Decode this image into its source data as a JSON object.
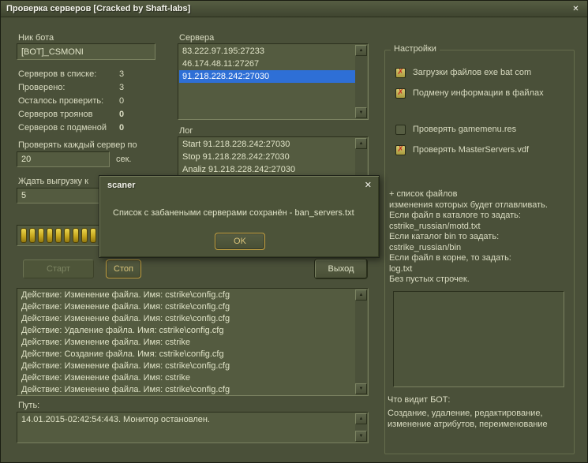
{
  "window": {
    "title": "Проверка серверов [Cracked by Shaft-labs]"
  },
  "icons": {
    "close": "✕",
    "arrow_up": "▲",
    "arrow_down": "▼",
    "check": "✗"
  },
  "left": {
    "nick_label": "Ник бота",
    "nick_value": "[BOT]_CSMONI",
    "stats": [
      {
        "label": "Серверов в списке:",
        "value": "3",
        "bold": false
      },
      {
        "label": "Проверено:",
        "value": "3",
        "bold": false
      },
      {
        "label": "Осталось проверить:",
        "value": "0",
        "bold": false
      },
      {
        "label": "Серверов троянов",
        "value": "0",
        "bold": true
      },
      {
        "label": "Серверов с подменой",
        "value": "0",
        "bold": true
      }
    ],
    "interval_label": "Проверять каждый сервер по",
    "interval_value": "20",
    "interval_unit": "сек.",
    "wait_label": "Ждать выгрузку к",
    "wait_value": "5",
    "start_button": "Старт",
    "stop_button": "Стоп"
  },
  "progress": {
    "blocks": 15
  },
  "servers": {
    "label": "Сервера",
    "items": [
      "83.222.97.195:27233",
      "46.174.48.11:27267",
      "91.218.228.242:27030"
    ],
    "selected_index": 2
  },
  "log": {
    "label": "Лог",
    "items": [
      "Start 91.218.228.242:27030",
      "Stop 91.218.228.242:27030",
      "Analiz 91.218.228.242:27030"
    ]
  },
  "exit_button": "Выход",
  "dialog": {
    "title": "scaner",
    "message": "Список с забанеными серверами сохранён - ban_servers.txt",
    "ok": "OK"
  },
  "settings": {
    "title": "Настройки",
    "checkboxes": [
      {
        "label": "Загрузки файлов exe bat com",
        "checked": true
      },
      {
        "label": "Подмену информации в файлах",
        "checked": true
      },
      {
        "label": "Проверять gamemenu.res",
        "checked": false
      },
      {
        "label": "Проверять MasterServers.vdf",
        "checked": true
      }
    ],
    "help_lines": [
      "+ список файлов",
      "изменения которых будет отлавливать.",
      "Если файл в каталоге то задать:",
      "cstrike_russian/motd.txt",
      "Если каталог bin то задать:",
      "cstrike_russian/bin",
      "Если файл в корне, то задать:",
      "log.txt",
      "Без пустых строчек."
    ],
    "bot_sees_label": "Что видит БОТ:",
    "bot_sees_text": "Создание, удаление, редактирование, изменение атрибутов, переименование"
  },
  "actions": {
    "items": [
      "Действие: Изменение файла. Имя: cstrike\\config.cfg",
      "Действие: Изменение файла. Имя: cstrike\\config.cfg",
      "Действие: Изменение файла. Имя: cstrike\\config.cfg",
      "Действие: Удаление файла. Имя: cstrike\\config.cfg",
      "Действие: Изменение файла. Имя: cstrike",
      "Действие: Создание файла. Имя: cstrike\\config.cfg",
      "Действие: Изменение файла. Имя: cstrike\\config.cfg",
      "Действие: Изменение файла. Имя: cstrike",
      "Действие: Изменение файла. Имя: cstrike\\config.cfg"
    ]
  },
  "path": {
    "label": "Путь:",
    "items": [
      "14.01.2015-02:42:54:443. Монитор остановлен."
    ]
  }
}
